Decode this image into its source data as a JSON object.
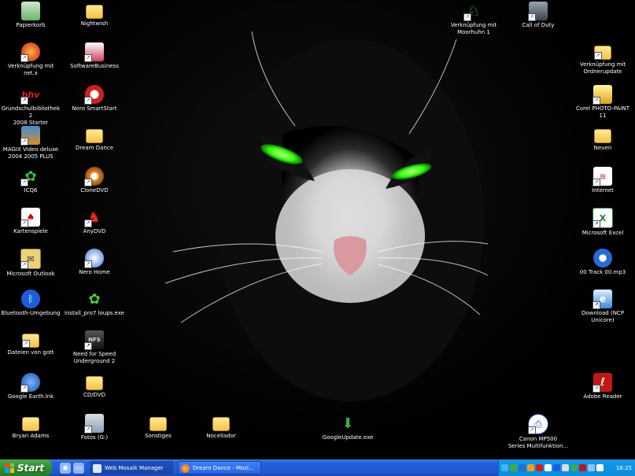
{
  "desktop": {
    "icons": [
      {
        "label": "Papierkorb",
        "icon": "recycle-bin-icon"
      },
      {
        "label": "Nightwish",
        "icon": "folder-icon"
      },
      {
        "label": "Verknüpfung mit\nnet.x",
        "icon": "firefox-icon"
      },
      {
        "label": "SoftwareBusiness",
        "icon": "software-box-icon"
      },
      {
        "label": "Grundschulbibliothek 2\n2008 Starter",
        "icon": "bhv-icon"
      },
      {
        "label": "Nero SmartStart",
        "icon": "nero-icon"
      },
      {
        "label": "MAGIX Video deluxe\n2004 2005 PLUS",
        "icon": "magix-icon"
      },
      {
        "label": "Dream Dance",
        "icon": "folder-icon"
      },
      {
        "label": "ICQ6",
        "icon": "icq-icon"
      },
      {
        "label": "CloneDVD",
        "icon": "clonedvd-icon"
      },
      {
        "label": "Kartenspiele",
        "icon": "cards-icon"
      },
      {
        "label": "AnyDVD",
        "icon": "anydvd-fox-icon"
      },
      {
        "label": "Microsoft Outlook",
        "icon": "outlook-icon"
      },
      {
        "label": "Nero Home",
        "icon": "nero-home-icon"
      },
      {
        "label": "Bluetooth-Umgebung",
        "icon": "bluetooth-icon"
      },
      {
        "label": "install_pro7 loups.exe",
        "icon": "flower-icon"
      },
      {
        "label": "Dateien von gott",
        "icon": "folder-icon"
      },
      {
        "label": "Need for Speed\nUnderground 2",
        "icon": "nfs-icon"
      },
      {
        "label": "Google Earth.lnk",
        "icon": "google-earth-icon"
      },
      {
        "label": "CD/DVD",
        "icon": "folder-icon"
      },
      {
        "label": "Bryan Adams",
        "icon": "folder-icon"
      },
      {
        "label": "Fotos (G:)",
        "icon": "drive-icon"
      },
      {
        "label": "Sonstiges",
        "icon": "folder-icon"
      },
      {
        "label": "Nocellador",
        "icon": "folder-icon"
      },
      {
        "label": "GoogleUpdate.exe",
        "icon": "google-update-icon"
      },
      {
        "label": "Canon MP500\nSeries Multifunktion...",
        "icon": "printer-icon"
      },
      {
        "label": "Verknüpfung mit\nMoorhuhn 1",
        "icon": "moorhuhn-icon"
      },
      {
        "label": "Call of Duty",
        "icon": "soldier-icon"
      },
      {
        "label": "Verknüpfung mit\nOrdnerupdate",
        "icon": "folder-shortcut-icon"
      },
      {
        "label": "Corel PHOTO-PAINT\n11",
        "icon": "corel-icon"
      },
      {
        "label": "Neuen",
        "icon": "folder-icon"
      },
      {
        "label": "Internet",
        "icon": "wifi-icon"
      },
      {
        "label": "Microsoft Excel",
        "icon": "excel-icon"
      },
      {
        "label": "00 Track 00.mp3",
        "icon": "media-icon"
      },
      {
        "label": "Download (NCP\nUnicore)",
        "icon": "ie-download-icon"
      },
      {
        "label": "Adobe Reader",
        "icon": "acrobat-icon"
      }
    ]
  },
  "taskbar": {
    "start_label": "Start",
    "quick_launch": [
      "browser-icon",
      "desktop-icon"
    ],
    "tasks": [
      {
        "label": "Web Mosaik Manager",
        "icon": "window-icon",
        "active": true
      },
      {
        "label": "Dream Dance - Mozi...",
        "icon": "firefox-icon",
        "active": false
      }
    ],
    "clock": "18:25"
  },
  "colors": {
    "taskbar": "#2461d6",
    "start": "#2e8a2e",
    "tray": "#0d8ddb",
    "cat_eyes": "#39ff14"
  }
}
